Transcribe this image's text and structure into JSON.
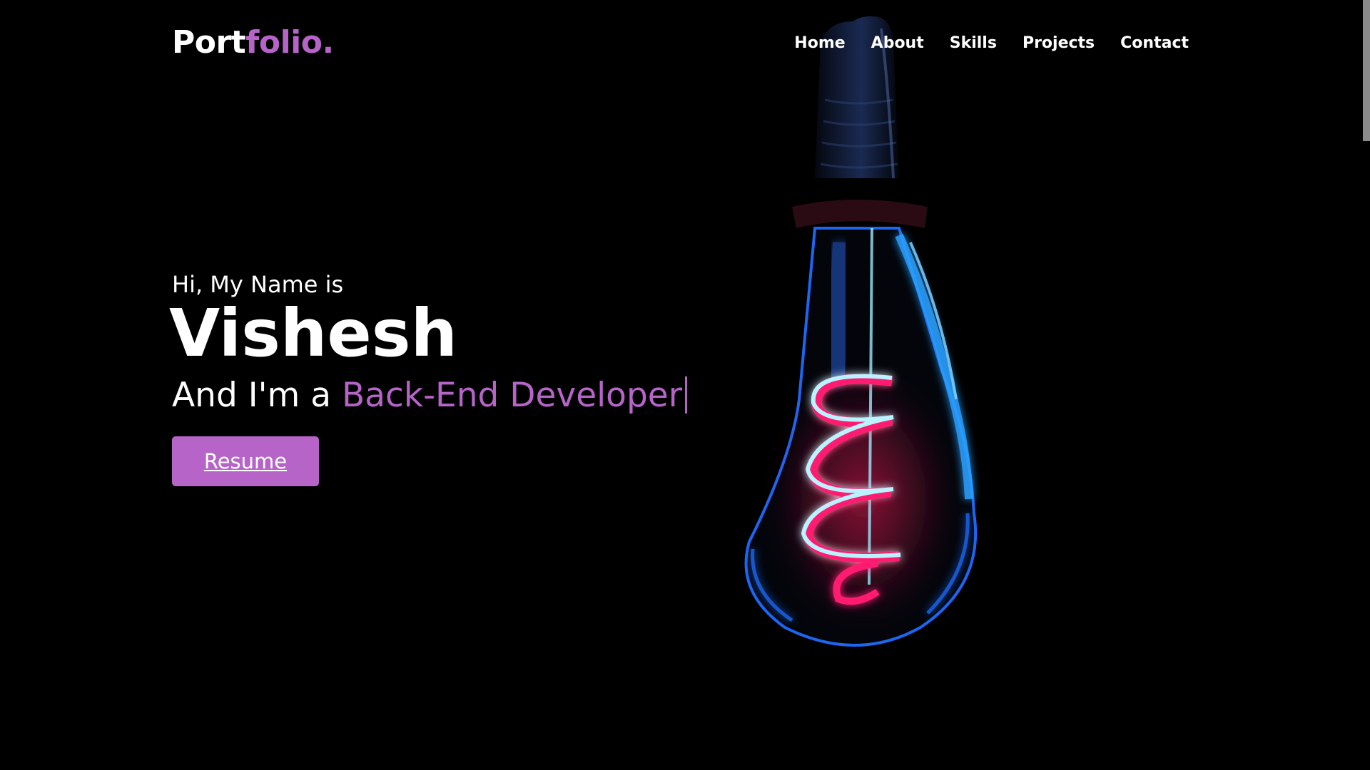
{
  "header": {
    "logo_main": "Port",
    "logo_accent": "folio.",
    "nav": [
      {
        "label": "Home"
      },
      {
        "label": "About"
      },
      {
        "label": "Skills"
      },
      {
        "label": "Projects"
      },
      {
        "label": "Contact"
      }
    ]
  },
  "hero": {
    "greeting": "Hi, My Name is",
    "name": "Vishesh",
    "role_prefix": "And I'm a ",
    "role": "Back-End Developer",
    "resume_label": "Resume"
  },
  "colors": {
    "background": "#000000",
    "accent": "#b664c8",
    "text": "#ffffff"
  },
  "icons": {
    "hero_image": "neon-light-bulb",
    "typing_cursor": "text-cursor"
  },
  "scroll": {
    "position_fraction": 0.0
  }
}
